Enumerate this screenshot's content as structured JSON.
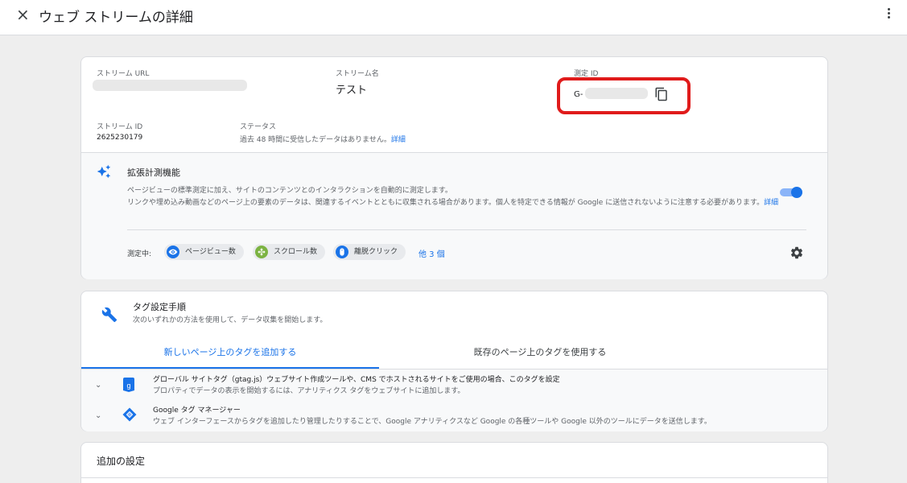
{
  "header": {
    "title": "ウェブ ストリームの詳細",
    "close_icon": "×"
  },
  "stream": {
    "url_label": "ストリーム URL",
    "name_label": "ストリーム名",
    "name_value": "テスト",
    "measurement_label": "測定 ID",
    "measurement_prefix": "G-",
    "id_label": "ストリーム ID",
    "id_value": "2625230179",
    "status_label": "ステータス",
    "status_text": "過去 48 時間に受信したデータはありません。",
    "status_link": "詳細"
  },
  "enhanced": {
    "title": "拡張計測機能",
    "description_1": "ページビューの標準測定に加え、サイトのコンテンツとのインタラクションを自動的に測定します。",
    "description_2": "リンクや埋め込み動画などのページ上の要素のデータは、関連するイベントとともに収集される場合があります。個人を特定できる情報が Google に送信されないように注意する必要があります。",
    "description_link": "詳細",
    "measuring_label": "測定中:",
    "chips": [
      {
        "label": "ページビュー数",
        "icon": "eye-icon",
        "color": "#1a73e8"
      },
      {
        "label": "スクロール数",
        "icon": "scroll-icon",
        "color": "#7cb342"
      },
      {
        "label": "離脱クリック",
        "icon": "mouse-icon",
        "color": "#1a73e8"
      }
    ],
    "more_link": "他 3 個",
    "enabled": true
  },
  "tagging": {
    "title": "タグ設定手順",
    "subtitle": "次のいずれかの方法を使用して、データ収集を開始します。",
    "tabs": [
      "新しいページ上のタグを追加する",
      "既存のページ上のタグを使用する"
    ],
    "active_tab": 0,
    "options": [
      {
        "title": "グローバル サイトタグ（gtag.js）ウェブサイト作成ツールや、CMS でホストされるサイトをご使用の場合、このタグを設定",
        "desc": "プロパティでデータの表示を開始するには、アナリティクス タグをウェブサイトに追加します。"
      },
      {
        "title": "Google タグ マネージャー",
        "desc": "ウェブ インターフェースからタグを追加したり管理したりすることで、Google アナリティクスなど Google の各種ツールや Google 以外のツールにデータを送信します。"
      }
    ]
  },
  "additional": {
    "title": "追加の設定"
  },
  "colors": {
    "accent": "#1a73e8",
    "highlight_border": "#e01b1b"
  }
}
